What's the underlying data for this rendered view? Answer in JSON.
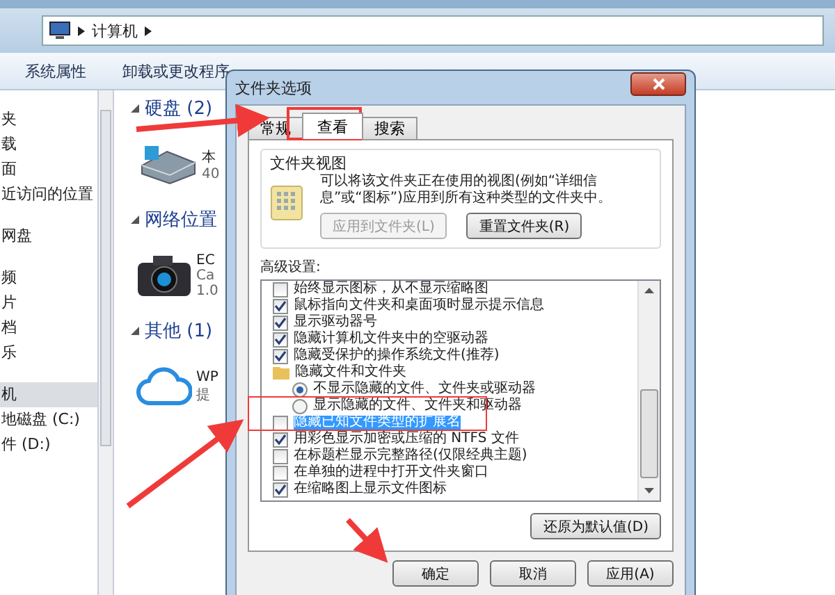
{
  "explorer": {
    "breadcrumb": [
      "计算机"
    ],
    "toolbar": [
      "系统属性",
      "卸载或更改程序"
    ],
    "nav_items": [
      {
        "label": "夹",
        "selected": false
      },
      {
        "label": "载",
        "selected": false
      },
      {
        "label": "面",
        "selected": false
      },
      {
        "label": "近访问的位置",
        "selected": false
      },
      {
        "label": "网盘",
        "selected": false
      },
      {
        "label": "频",
        "selected": false
      },
      {
        "label": "片",
        "selected": false
      },
      {
        "label": "档",
        "selected": false
      },
      {
        "label": "乐",
        "selected": false
      },
      {
        "label": "机",
        "selected": true
      },
      {
        "label": "地磁盘 (C:)",
        "selected": false
      },
      {
        "label": "件 (D:)",
        "selected": false
      }
    ],
    "groups": [
      {
        "title": "硬盘 (2)",
        "items": [
          {
            "kind": "drive",
            "lines": [
              "本",
              "40"
            ]
          }
        ]
      },
      {
        "title": "网络位置",
        "items": [
          {
            "kind": "camera",
            "lines": [
              "EC",
              "Ca",
              "1.0"
            ]
          }
        ]
      },
      {
        "title": "其他 (1)",
        "items": [
          {
            "kind": "cloud",
            "lines": [
              "WP",
              "提"
            ]
          }
        ]
      }
    ]
  },
  "dialog": {
    "title": "文件夹选项",
    "tabs": [
      {
        "label": "常规",
        "selected": false
      },
      {
        "label": "查看",
        "selected": true
      },
      {
        "label": "搜索",
        "selected": false
      }
    ],
    "folder_views": {
      "title": "文件夹视图",
      "description": "可以将该文件夹正在使用的视图(例如“详细信息”或“图标”)应用到所有这种类型的文件夹中。",
      "buttons": [
        {
          "label": "应用到文件夹(L)",
          "disabled": true
        },
        {
          "label": "重置文件夹(R)",
          "disabled": false
        }
      ]
    },
    "advanced_label": "高级设置:",
    "settings": [
      {
        "kind": "checkbox",
        "label": "始终显示图标，从不显示缩略图",
        "checked": false,
        "selected": false
      },
      {
        "kind": "checkbox",
        "label": "鼠标指向文件夹和桌面项时显示提示信息",
        "checked": true,
        "selected": false
      },
      {
        "kind": "checkbox",
        "label": "显示驱动器号",
        "checked": true,
        "selected": false
      },
      {
        "kind": "checkbox",
        "label": "隐藏计算机文件夹中的空驱动器",
        "checked": true,
        "selected": false
      },
      {
        "kind": "checkbox",
        "label": "隐藏受保护的操作系统文件(推荐)",
        "checked": true,
        "selected": false
      },
      {
        "kind": "folder",
        "label": "隐藏文件和文件夹",
        "selected": false,
        "children": [
          {
            "kind": "radio",
            "label": "不显示隐藏的文件、文件夹或驱动器",
            "checked": true,
            "selected": false
          },
          {
            "kind": "radio",
            "label": "显示隐藏的文件、文件夹和驱动器",
            "checked": false,
            "selected": false
          }
        ]
      },
      {
        "kind": "checkbox",
        "label": "隐藏已知文件类型的扩展名",
        "checked": false,
        "selected": true
      },
      {
        "kind": "checkbox",
        "label": "用彩色显示加密或压缩的 NTFS 文件",
        "checked": true,
        "selected": false
      },
      {
        "kind": "checkbox",
        "label": "在标题栏显示完整路径(仅限经典主题)",
        "checked": false,
        "selected": false
      },
      {
        "kind": "checkbox",
        "label": "在单独的进程中打开文件夹窗口",
        "checked": false,
        "selected": false
      },
      {
        "kind": "checkbox",
        "label": "在缩略图上显示文件图标",
        "checked": true,
        "selected": false
      }
    ],
    "restore_button": "还原为默认值(D)",
    "buttons": [
      "确定",
      "取消",
      "应用(A)"
    ]
  }
}
